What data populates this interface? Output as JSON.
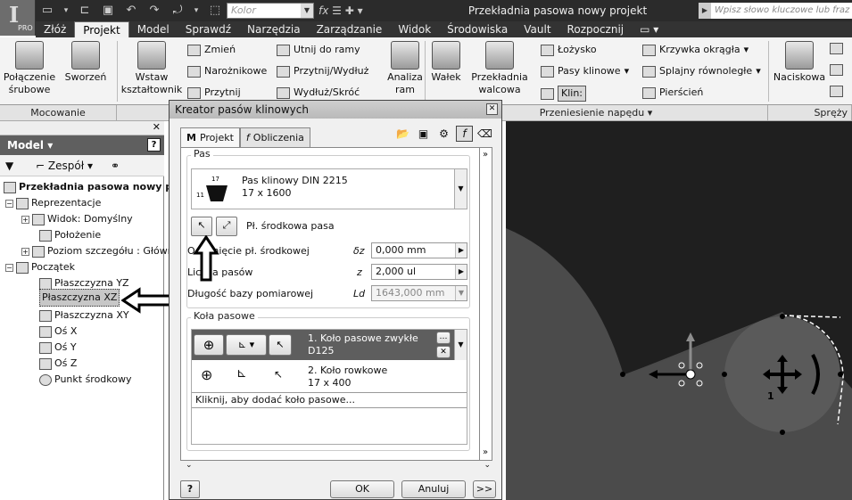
{
  "app": {
    "logo_letter": "I",
    "logo_badge": "PRO",
    "window_title": "Przekładnia pasowa nowy projekt"
  },
  "quick_access": {
    "color_value": "Kolor",
    "fx_symbol": "fx",
    "search_placeholder": "Wpisz słowo kluczowe lub fraz"
  },
  "tabs": [
    "Złóż",
    "Projekt",
    "Model",
    "Sprawdź",
    "Narzędzia",
    "Zarządzanie",
    "Widok",
    "Środowiska",
    "Vault",
    "Rozpocznij"
  ],
  "ribbon": {
    "polaczenie": "Połączenie\nśrubowe",
    "sworzen": "Sworzeń",
    "wstaw": "Wstaw\nkształtownik",
    "zmien": "Zmień",
    "naroznikowe": "Narożnikowe",
    "przytnij": "Przytnij",
    "utnij": "Utnij do ramy",
    "przytnij_wydluz": "Przytnij/Wydłuż",
    "wydluz_skroc": "Wydłuż/Skróć",
    "analiza": "Analiza\nram",
    "walek": "Wałek",
    "przekladnia": "Przekładnia\nwalcowa",
    "lozysko": "Łożysko",
    "pasy": "Pasy klinowe",
    "klin": "Klin:",
    "krzywka": "Krzywka okrągła",
    "splajny": "Splajny równoległe",
    "pierscien": "Pierścień",
    "naciskowa": "Naciskowa",
    "group_mocowanie": "Mocowanie",
    "group_przeniesienie": "Przeniesienie napędu",
    "group_sprezyny": "Spręży"
  },
  "browser": {
    "header": "Model",
    "assembly_filter": "Zespół",
    "items": [
      {
        "label": "Przekładnia pasowa nowy p",
        "bold": true
      },
      {
        "label": "Reprezentacje"
      },
      {
        "label": "Widok: Domyślny"
      },
      {
        "label": "Położenie"
      },
      {
        "label": "Poziom szczegółu : Główn"
      },
      {
        "label": "Początek"
      },
      {
        "label": "Płaszczyzna YZ"
      },
      {
        "label": "Płaszczyzna XZ"
      },
      {
        "label": "Płaszczyzna XY"
      },
      {
        "label": "Oś X"
      },
      {
        "label": "Oś Y"
      },
      {
        "label": "Oś Z"
      },
      {
        "label": "Punkt środkowy"
      }
    ]
  },
  "dialog": {
    "title": "Kreator pasów klinowych",
    "tab_projekt": "Projekt",
    "tab_obliczenia": "Obliczenia",
    "pas_group": "Pas",
    "belt_name": "Pas klinowy DIN 2215",
    "belt_size": "17 x 1600",
    "belt_dim_top": "17",
    "belt_dim_side": "11",
    "centerline_label": "Pł. środkowa pasa",
    "offset_label": "Odsunięcie pł. środkowej",
    "offset_symbol": "δz",
    "offset_value": "0,000 mm",
    "count_label": "Liczba pasów",
    "count_symbol": "z",
    "count_value": "2,000 ul",
    "length_label": "Długość bazy pomiarowej",
    "length_symbol": "Ld",
    "length_value": "1643,000 mm",
    "pulleys_group": "Koła pasowe",
    "pulley1_line1": "1. Koło pasowe zwykłe",
    "pulley1_line2": "D125",
    "pulley2_line1": "2. Koło rowkowe",
    "pulley2_line2": "17 x 400",
    "add_pulley": "Kliknij, aby dodać koło pasowe...",
    "ok": "OK",
    "cancel": "Anuluj",
    "more": ">>",
    "help": "?"
  },
  "viewport": {
    "pulley_label": "1"
  }
}
